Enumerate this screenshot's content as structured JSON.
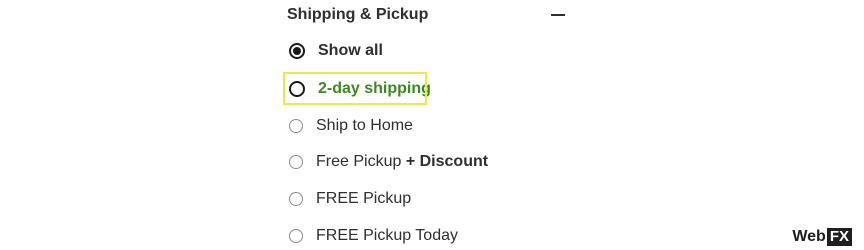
{
  "facet": {
    "title": "Shipping & Pickup",
    "collapse_icon": "minus-icon",
    "options": [
      {
        "label": "Show all",
        "selected": true
      },
      {
        "label": "2-day shipping",
        "selected": false,
        "highlighted": true
      },
      {
        "label": "Ship to Home",
        "selected": false
      },
      {
        "label_prefix": "Free Pickup",
        "label_plus": "+",
        "label_suffix": "Discount",
        "selected": false
      },
      {
        "label": "FREE Pickup",
        "selected": false
      },
      {
        "label": "FREE Pickup Today",
        "selected": false
      }
    ]
  },
  "colors": {
    "highlight_text": "#3a8a1f",
    "highlight_border": "#e9e94a",
    "text": "#2e2f32"
  },
  "brand": {
    "text_left": "Web",
    "text_box": "FX"
  }
}
